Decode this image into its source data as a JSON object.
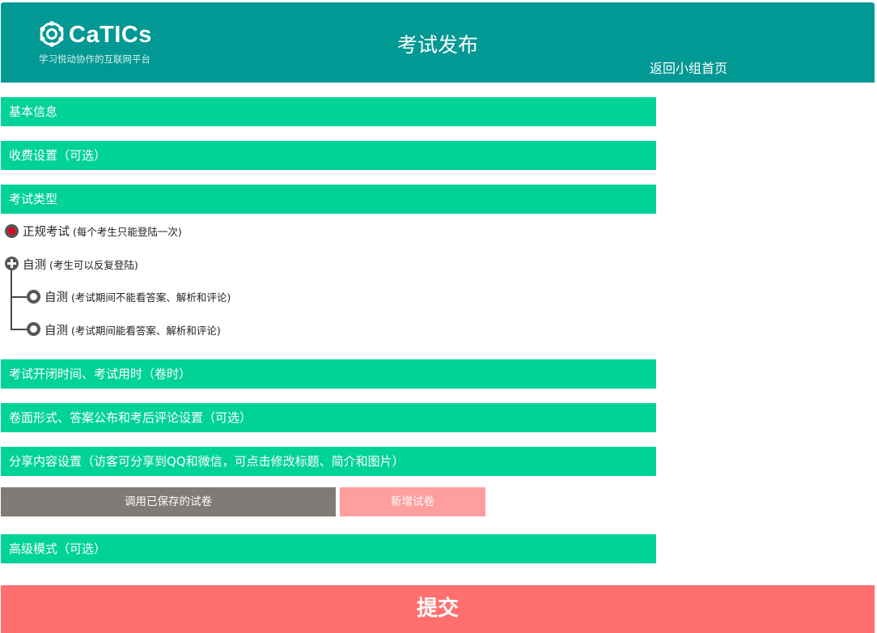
{
  "header": {
    "logo_text": "CaTICs",
    "logo_tagline": "学习悦动协作的互联网平台",
    "title": "考试发布",
    "back_link": "返回小组首页",
    "bg_color": "#029893"
  },
  "sections": {
    "basic_info": "基本信息",
    "fee_settings": "收费设置（可选）",
    "exam_type": "考试类型",
    "time_settings": "考试开闭时间、考试用时（卷时）",
    "paper_format": "卷面形式、答案公布和考后评论设置（可选）",
    "share_settings": "分享内容设置（访客可分享到QQ和微信，可点击修改标题、简介和图片）",
    "advanced_mode": "高级模式（可选）",
    "bar_color": "#00d298"
  },
  "exam_type": {
    "formal": {
      "label": "正规考试",
      "note": "(每个考生只能登陆一次)",
      "selected": true
    },
    "self_test": {
      "label": "自测",
      "note": "(考生可以反复登陆)"
    },
    "self_test_no_answers": {
      "label": "自测",
      "note": "(考试期间不能看答案、解析和评论)"
    },
    "self_test_with_answers": {
      "label": "自测",
      "note": "(考试期间能看答案、解析和评论)"
    }
  },
  "buttons": {
    "load_saved": "调用已保存的试卷",
    "new_paper": "新增试卷",
    "submit": "提交",
    "load_saved_color": "#807b76",
    "new_paper_color": "#ff9e9e",
    "submit_color": "#ff6f6f"
  },
  "icons": {
    "logo": "catics-logo-icon",
    "selected_radio": "radio-selected-icon",
    "expand": "plus-circle-icon",
    "radio": "radio-icon"
  }
}
